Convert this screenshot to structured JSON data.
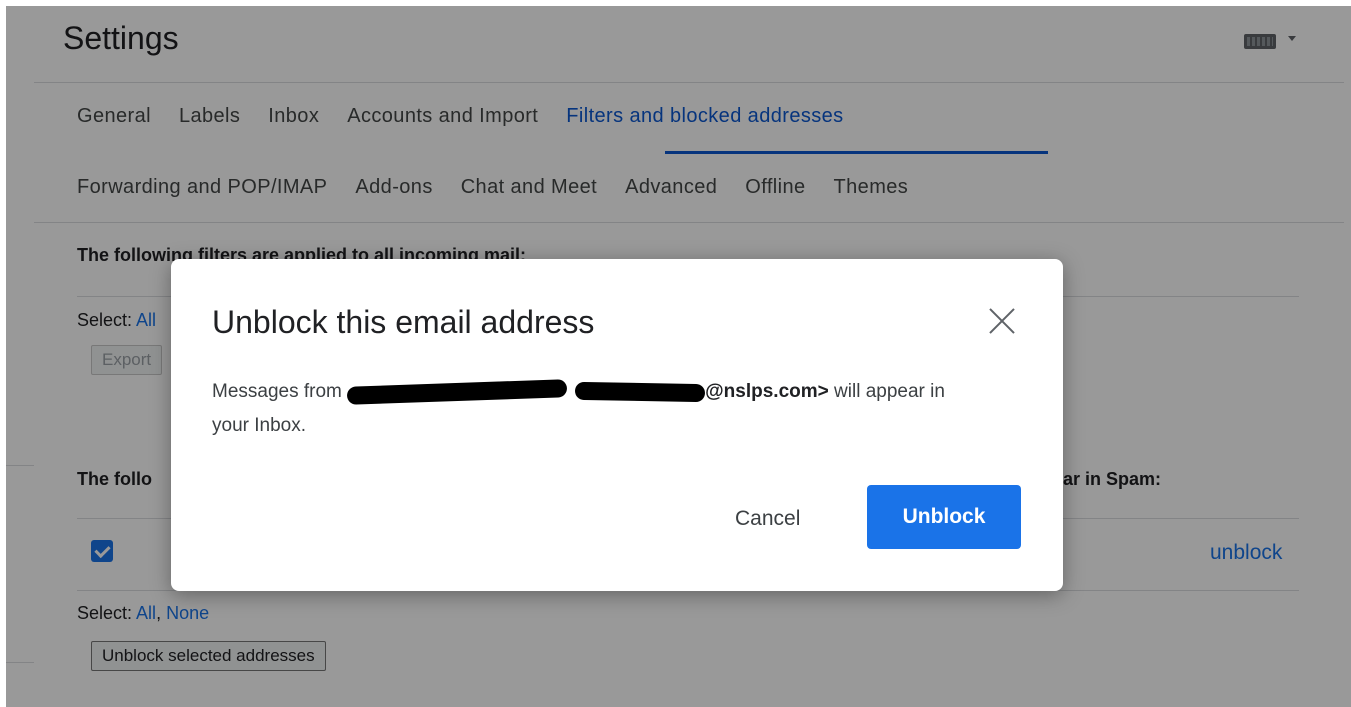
{
  "header": {
    "title": "Settings",
    "keyboard_icon": "keyboard-icon"
  },
  "tabs_row1": [
    {
      "label": "General"
    },
    {
      "label": "Labels"
    },
    {
      "label": "Inbox"
    },
    {
      "label": "Accounts and Import"
    },
    {
      "label": "Filters and blocked addresses",
      "active": true
    }
  ],
  "tabs_row2": [
    {
      "label": "Forwarding and POP/IMAP"
    },
    {
      "label": "Add-ons"
    },
    {
      "label": "Chat and Meet"
    },
    {
      "label": "Advanced"
    },
    {
      "label": "Offline"
    },
    {
      "label": "Themes"
    }
  ],
  "filters_section": {
    "heading": "The following filters are applied to all incoming mail:",
    "select_prefix": "Select: ",
    "select_all": "All",
    "export_button": "Export"
  },
  "blocked_section": {
    "heading_tail": "ar in Spam:",
    "heading_visible": "The follo",
    "row_unblock_link": "unblock",
    "select_prefix": "Select: ",
    "select_all": "All",
    "select_sep": ", ",
    "select_none": "None",
    "unblock_selected_button": "Unblock selected addresses"
  },
  "dialog": {
    "title": "Unblock this email address",
    "body_prefix": "Messages from ",
    "email_suffix": "@nslps.com>",
    "body_suffix": " will appear in your Inbox.",
    "cancel_label": "Cancel",
    "confirm_label": "Unblock"
  },
  "colors": {
    "accent": "#1a73e8",
    "active_tab": "#0b57d0",
    "overlay": "rgba(0,0,0,0.4)"
  }
}
